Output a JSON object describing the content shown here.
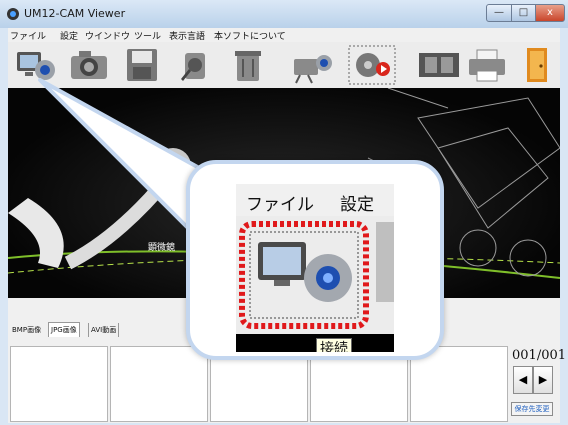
{
  "window": {
    "title": "UM12-CAM Viewer",
    "controls": {
      "minimize": "—",
      "maximize": "□",
      "close": "x"
    }
  },
  "menu": [
    "ファイル",
    "設定",
    "ウインドウ",
    "ツール",
    "表示言語",
    "本ソフトについて"
  ],
  "toolbar": {
    "buttons": [
      {
        "icon": "connect-monitor-camera-icon"
      },
      {
        "icon": "camera-snapshot-icon"
      },
      {
        "icon": "save-disk-icon"
      },
      {
        "icon": "settings-camera-icon"
      },
      {
        "icon": "trash-icon"
      },
      {
        "icon": "video-camera-icon"
      },
      {
        "icon": "record-film-icon"
      },
      {
        "icon": "film-strip-icon"
      },
      {
        "icon": "printer-icon"
      },
      {
        "icon": "exit-door-icon"
      }
    ]
  },
  "banner": {
    "text": "顕微鏡"
  },
  "tabs": [
    "BMP画像",
    "JPG画像",
    "AVI動画"
  ],
  "active_tab": "JPG画像",
  "pager": {
    "counter": "001/001",
    "prev": "◀",
    "next": "▶",
    "save_dest": "保存先変更"
  },
  "zoom_callout": {
    "menu": [
      "ファイル",
      "設定"
    ],
    "tooltip": "接続"
  },
  "colors": {
    "accent_red": "#e0191b",
    "highlight_blue": "#c3d6ef",
    "title_bg": "#c9dcf0"
  }
}
